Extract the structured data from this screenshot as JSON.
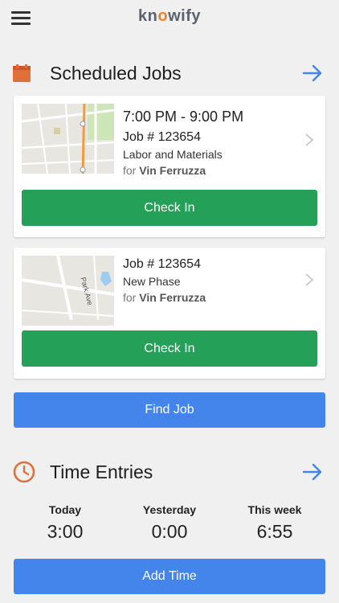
{
  "app": {
    "logo_text_pre": "kn",
    "logo_text_o": "o",
    "logo_text_post": "wify"
  },
  "scheduled": {
    "title": "Scheduled Jobs",
    "jobs": [
      {
        "time": "7:00 PM - 9:00 PM",
        "number": "Job # 123654",
        "description": "Labor and Materials",
        "for_prefix": "for",
        "customer": "Vin Ferruzza",
        "button": "Check In"
      },
      {
        "time": "",
        "number": "Job # 123654",
        "description": "New Phase",
        "for_prefix": "for",
        "customer": "Vin Ferruzza",
        "button": "Check In"
      }
    ],
    "find_button": "Find Job"
  },
  "map2": {
    "street_label": "Park Ave"
  },
  "time_entries": {
    "title": "Time Entries",
    "stats": [
      {
        "label": "Today",
        "value": "3:00"
      },
      {
        "label": "Yesterday",
        "value": "0:00"
      },
      {
        "label": "This week",
        "value": "6:55"
      }
    ],
    "add_button": "Add Time"
  },
  "colors": {
    "accent_blue": "#4485ec",
    "check_in_green": "#24a058",
    "icon_orange": "#e0703a"
  }
}
